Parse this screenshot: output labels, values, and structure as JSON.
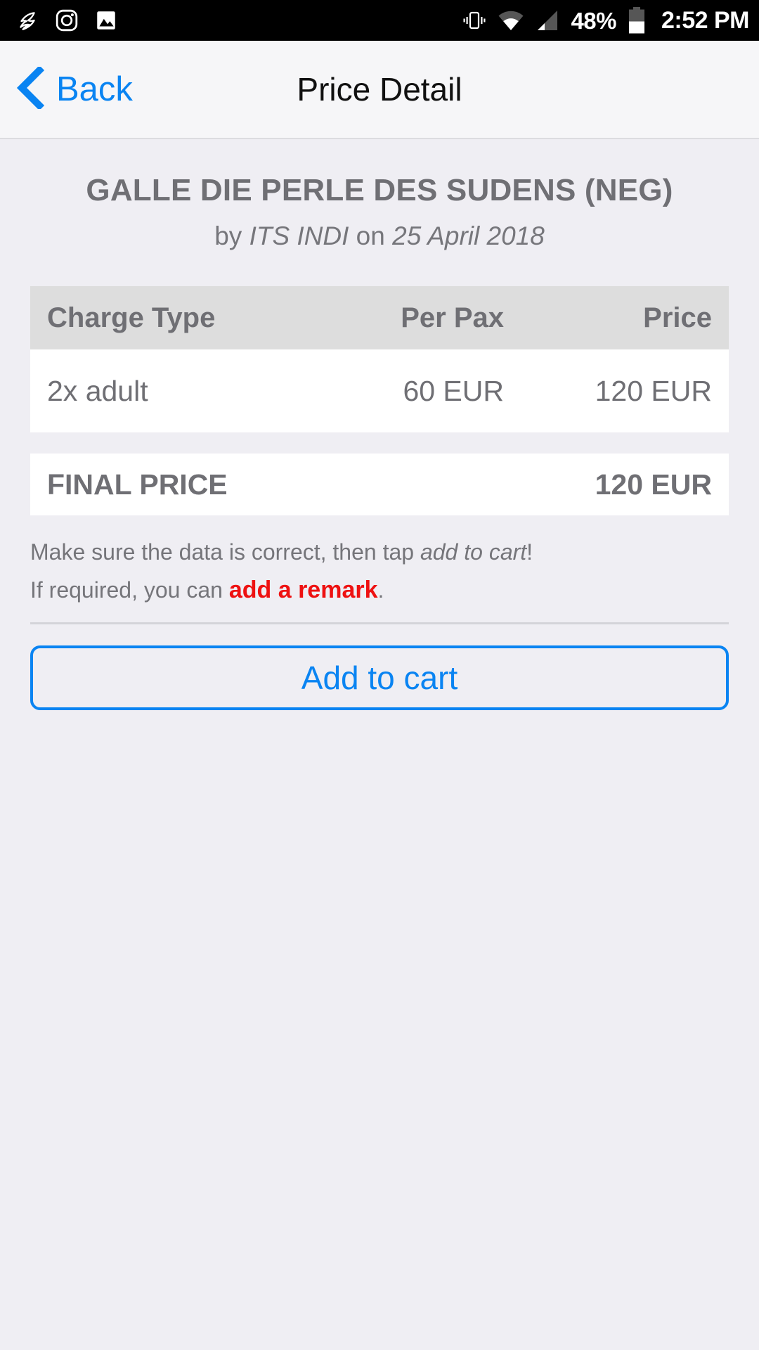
{
  "status_bar": {
    "notification_icons": [
      "swallow-bird-icon",
      "instagram-icon",
      "photo-gallery-icon"
    ],
    "system_icons": [
      "vibrate-icon",
      "wifi-icon",
      "cellular-signal-icon",
      "battery-icon"
    ],
    "battery_percent": "48%",
    "clock": "2:52 PM",
    "background_color": "#000000",
    "foreground_color": "#FFFFFF"
  },
  "nav_bar": {
    "back_label": "Back",
    "back_icon": "chevron-left-icon",
    "title": "Price Detail",
    "accent_color": "#0A84F2",
    "background_color": "#F6F6F8"
  },
  "tour": {
    "name": "GALLE DIE PERLE DES SUDENS (NEG)",
    "by_prefix": "by ",
    "supplier": "ITS INDI",
    "on_prefix": " on ",
    "date": "25 April 2018"
  },
  "price_table": {
    "columns": [
      "Charge Type",
      "Per Pax",
      "Price"
    ],
    "rows": [
      {
        "charge_type": "2x adult",
        "per_pax": "60 EUR",
        "price": "120 EUR"
      }
    ],
    "header_background": "#DDDDDD",
    "row_background": "#FFFFFF",
    "text_color": "#6F6F74"
  },
  "final_price": {
    "label": "FINAL PRICE",
    "value": "120 EUR"
  },
  "hints": {
    "line1_part1": "Make sure the data is correct, then tap ",
    "line1_emphasis": "add to cart",
    "line1_part2": "!",
    "line2_part1": "If required, you can ",
    "line2_link": "add a remark",
    "line2_part2": ".",
    "link_color": "#EE1111"
  },
  "cart_button": {
    "label": "Add to cart",
    "border_color": "#0A84F2",
    "text_color": "#0A84F2"
  },
  "page": {
    "background_color": "#EFEEF3"
  }
}
